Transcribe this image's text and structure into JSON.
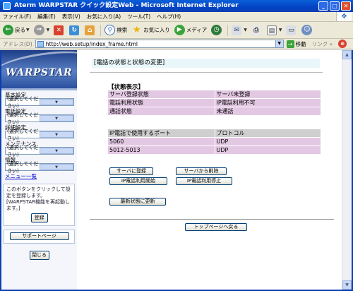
{
  "window": {
    "title": "Aterm WARPSTAR クイック設定Web - Microsoft Internet Explorer",
    "minimize": "_",
    "maximize": "□",
    "close": "✕"
  },
  "menubar": {
    "items": [
      "ファイル(F)",
      "編集(E)",
      "表示(V)",
      "お気に入り(A)",
      "ツール(T)",
      "ヘルプ(H)"
    ]
  },
  "toolbar": {
    "back_label": "戻る",
    "search_label": "検索",
    "favorites_label": "お気に入り",
    "media_label": "メディア"
  },
  "addressbar": {
    "label": "アドレス(D)",
    "url": "http://web.setup/index_frame.html",
    "go_label": "移動",
    "links_label": "リンク"
  },
  "sidebar": {
    "logo_text": "WARPSTAR",
    "groups": [
      {
        "heading": "基本設定",
        "selected": "(選択してください)"
      },
      {
        "heading": "電話設定",
        "selected": "(選択してください)"
      },
      {
        "heading": "詳細設定",
        "selected": "(選択してください)"
      },
      {
        "heading": "メンテナンス",
        "selected": "(選択してください)"
      },
      {
        "heading": "情報",
        "selected": "(選択してください)"
      }
    ],
    "menu_list_link": "メニュー一覧",
    "register_note": "このボタンをクリックして設定を登録します。[WARPSTAR機能を再起動します。]",
    "register_button": "登録",
    "support_button": "サポートページ",
    "close_button": "閉じる"
  },
  "main": {
    "page_title": "[電話の状態と状態の変更]",
    "status_section_label": "【状態表示】",
    "status_rows": [
      {
        "label": "サーバ登録状態",
        "value": "サーバ未登録"
      },
      {
        "label": "電話利用状態",
        "value": "IP電話利用不可"
      },
      {
        "label": "通話状態",
        "value": "未通話"
      }
    ],
    "port_table": {
      "headers": [
        "IP電話で使用するポート",
        "プロトコル"
      ],
      "rows": [
        {
          "port": "5060",
          "protocol": "UDP"
        },
        {
          "port": "5012-5013",
          "protocol": "UDP"
        }
      ]
    },
    "buttons": {
      "server_register": "サーバに登録",
      "server_delete": "サーバから削除",
      "ip_start": "IP電話利用開始",
      "ip_stop": "IP電話利用停止",
      "refresh": "最新状態に更新",
      "top_page": "トップページへ戻る"
    }
  }
}
